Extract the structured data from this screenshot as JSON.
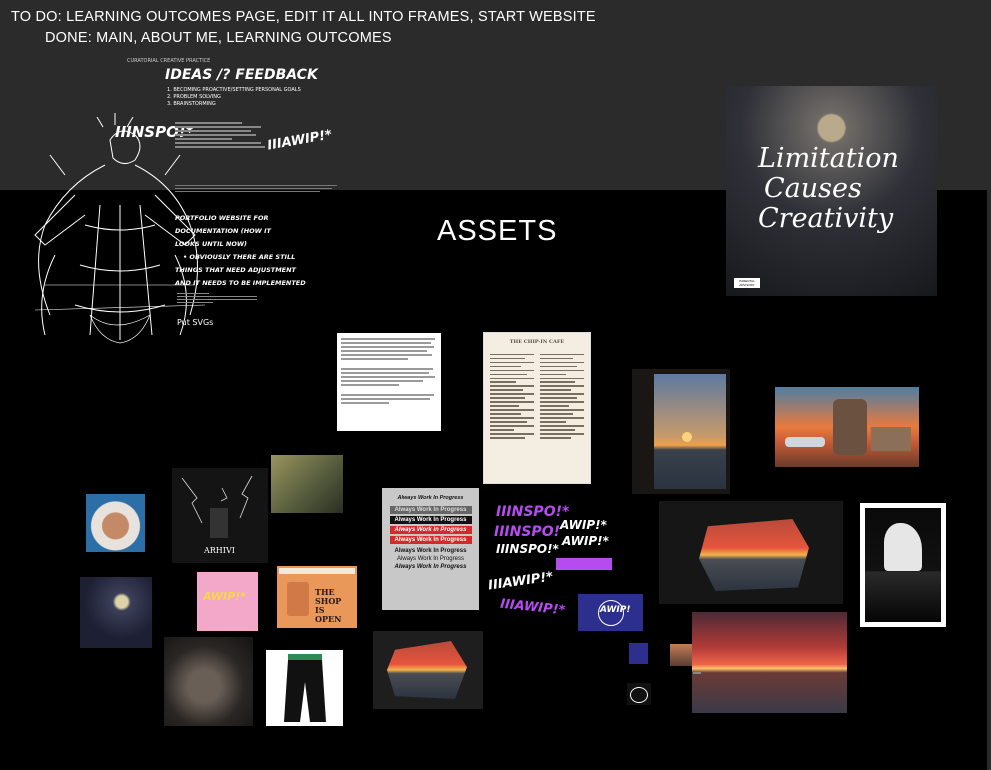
{
  "notes": {
    "todo": "TO DO: LEARNING OUTCOMES PAGE, EDIT IT ALL INTO FRAMES, START WEBSITE",
    "done": "DONE: MAIN, ABOUT ME, LEARNING OUTCOMES"
  },
  "frame": {
    "title": "ASSETS"
  },
  "sketch": {
    "header": "IDEAS /? FEEDBACK",
    "small_header": "CURATORIAL CREATIVE PRACTICE",
    "list": [
      "1. BECOMING PROACTIVE/SETTING PERSONAL GOALS",
      "2. PROBLEM SOLVING",
      "3. BRAINSTORMING"
    ],
    "inspo": "IIINSPO!*",
    "awip": "IIIAWIP!*",
    "portfolio": [
      "PORTFOLIO WEBSITE FOR",
      "DOCUMENTATION (HOW IT",
      "LOOKS UNTIL NOW)",
      "• OBVIOUSLY THERE ARE STILL",
      "THINGS THAT NEED ADJUSTMENT",
      "AND IT NEEDS TO BE IMPLEMENTED"
    ],
    "svg_note": "Put SVGs"
  },
  "album": {
    "lines": [
      "Limitation",
      "Causes",
      "Creativity"
    ],
    "badge": "PARENTAL ADVISORY"
  },
  "menu_card": {
    "title": "THE CHIP-IN CAFE"
  },
  "shop_card": {
    "title": "THE SHOP IS OPEN"
  },
  "awip_sheet": {
    "heading": "Always Work In Progress",
    "rows": [
      "Always Work In Progress",
      "Always Work In Progress",
      "Always Work In Progress",
      "Always Work In Progress",
      "Always Work In Progress",
      "Always Work In Progress",
      "Always Work In Progress"
    ]
  },
  "stickers": [
    "IIINSPO!*",
    "IIINSPO!",
    "IIINSPO!*",
    "AWIP!*",
    "AWIP!*",
    "IIIAWIP!*",
    "IIIAWIP!*",
    "AWIP!"
  ],
  "arhivi": "ARHIVI",
  "colors": {
    "bg": "#2b2b2b",
    "frame": "#000000",
    "purple": "#b64cf0",
    "navy": "#2d2f8f"
  }
}
